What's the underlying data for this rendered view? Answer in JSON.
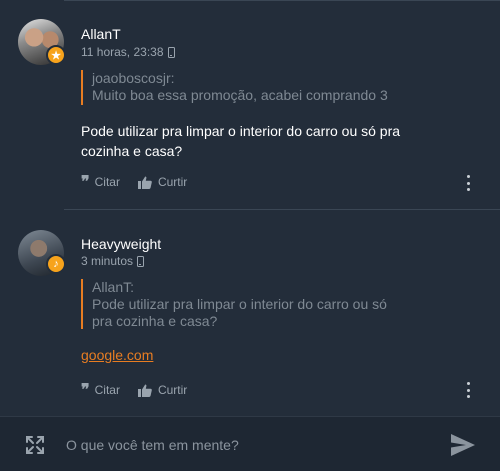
{
  "comments": [
    {
      "username": "AllanT",
      "timestamp": "11 horas, 23:38",
      "device_icon": "phone-icon",
      "badge_icon": "star-badge-icon",
      "quote": {
        "author": "joaoboscosjr:",
        "text": "Muito boa essa promoção, acabei comprando 3"
      },
      "body": "Pode utilizar pra limpar o interior do carro ou só pra cozinha e casa?",
      "actions": {
        "quote_label": "Citar",
        "like_label": "Curtir"
      }
    },
    {
      "username": "Heavyweight",
      "timestamp": "3 minutos",
      "device_icon": "phone-icon",
      "badge_icon": "music-badge-icon",
      "quote": {
        "author": "AllanT:",
        "text": "Pode utilizar pra limpar o interior do carro ou só pra cozinha e casa?"
      },
      "body_link": "google.com",
      "actions": {
        "quote_label": "Citar",
        "like_label": "Curtir"
      }
    }
  ],
  "composer": {
    "placeholder": "O que você tem em mente?"
  },
  "colors": {
    "background": "#232d3a",
    "accent": "#e87d22",
    "badge": "#f7a31c"
  }
}
